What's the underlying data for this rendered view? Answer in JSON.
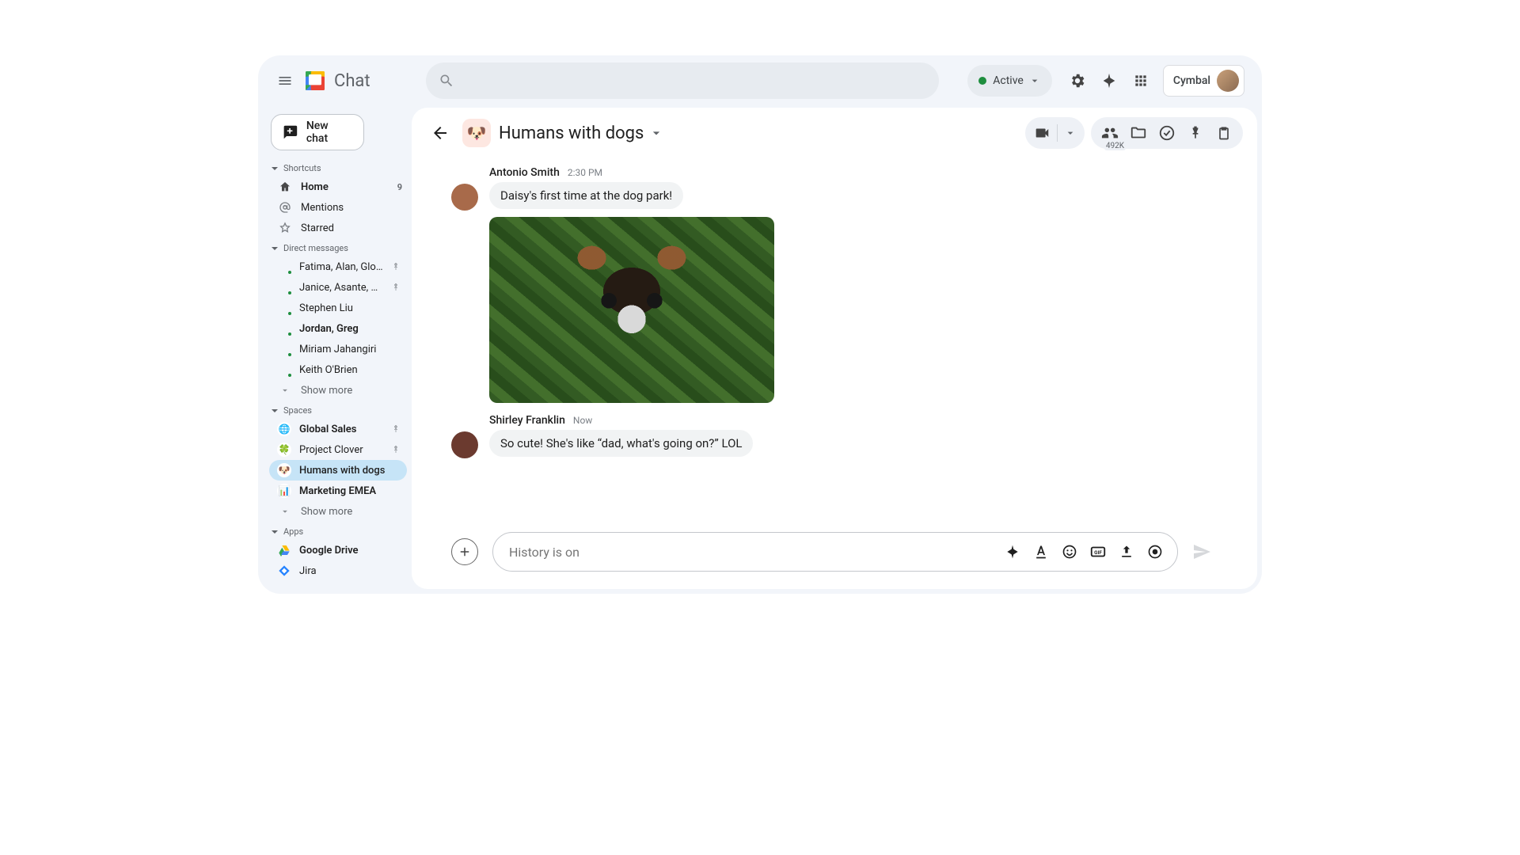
{
  "header": {
    "app_title": "Chat",
    "presence_label": "Active",
    "org_name": "Cymbal"
  },
  "sidebar": {
    "new_chat": "New chat",
    "sections": {
      "shortcuts": {
        "title": "Shortcuts",
        "items": [
          {
            "label": "Home",
            "badge": "9"
          },
          {
            "label": "Mentions"
          },
          {
            "label": "Starred"
          }
        ]
      },
      "dms": {
        "title": "Direct messages",
        "items": [
          {
            "label": "Fatima, Alan, Glo...",
            "pinned": true
          },
          {
            "label": "Janice, Asante, He...",
            "pinned": true
          },
          {
            "label": "Stephen Liu"
          },
          {
            "label": "Jordan, Greg",
            "bold": true
          },
          {
            "label": "Miriam Jahangiri"
          },
          {
            "label": "Keith O'Brien"
          }
        ],
        "show_more": "Show more"
      },
      "spaces": {
        "title": "Spaces",
        "items": [
          {
            "label": "Global Sales",
            "pinned": true,
            "bold": true,
            "emoji": "🌐"
          },
          {
            "label": "Project Clover",
            "pinned": true,
            "emoji": "🍀"
          },
          {
            "label": "Humans with dogs",
            "selected": true,
            "emoji": "🐶"
          },
          {
            "label": "Marketing EMEA",
            "bold": true,
            "emoji": "📊"
          }
        ],
        "show_more": "Show more"
      },
      "apps": {
        "title": "Apps",
        "items": [
          {
            "label": "Google Drive",
            "bold": true
          },
          {
            "label": "Jira"
          }
        ]
      }
    }
  },
  "room": {
    "emoji": "🐶",
    "title": "Humans with dogs",
    "member_count": "492K"
  },
  "messages": [
    {
      "author": "Antonio Smith",
      "time": "2:30 PM",
      "text": "Daisy's first time at the dog park!",
      "has_attachment": true,
      "avatar_color": "#a86a4a"
    },
    {
      "author": "Shirley Franklin",
      "time": "Now",
      "text": "So cute! She's like “dad, what's going on?” LOL",
      "has_attachment": false,
      "avatar_color": "#6b3a2f"
    }
  ],
  "composer": {
    "placeholder": "History is on"
  }
}
